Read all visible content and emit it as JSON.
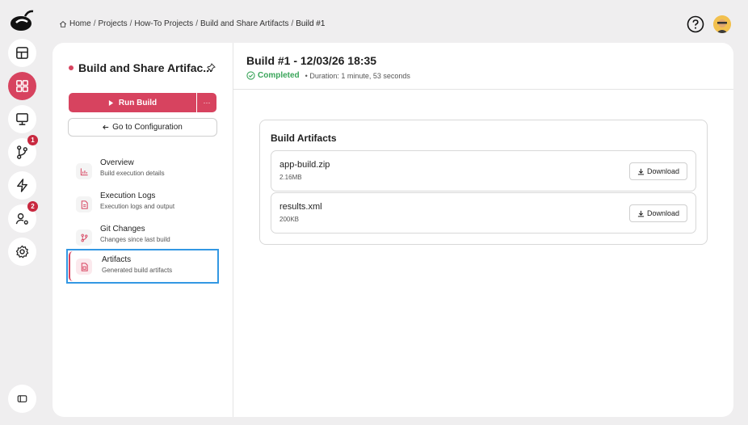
{
  "breadcrumb": {
    "items": [
      "Home",
      "Projects",
      "How-To Projects",
      "Build and Share Artifacts"
    ],
    "current": "Build #1",
    "separator": "/"
  },
  "rail": {
    "badges": {
      "git": "1",
      "users": "2"
    }
  },
  "left_panel": {
    "title": "Build and Share Artifac...",
    "run_label": "Run Build",
    "run_more_label": "···",
    "config_label": "Go to Configuration",
    "nav": [
      {
        "title": "Overview",
        "subtitle": "Build execution details"
      },
      {
        "title": "Execution Logs",
        "subtitle": "Execution logs and output"
      },
      {
        "title": "Git Changes",
        "subtitle": "Changes since last build"
      },
      {
        "title": "Artifacts",
        "subtitle": "Generated build artifacts"
      }
    ]
  },
  "build": {
    "title": "Build #1 - 12/03/26 18:35",
    "status": "Completed",
    "duration": "• Duration: 1 minute, 53 seconds"
  },
  "artifacts": {
    "heading": "Build Artifacts",
    "download_label": "Download",
    "items": [
      {
        "name": "app-build.zip",
        "size": "2.16MB"
      },
      {
        "name": "results.xml",
        "size": "200KB"
      }
    ]
  },
  "colors": {
    "accent": "#d7435f",
    "success": "#3aa55a",
    "focus": "#3398e3"
  }
}
